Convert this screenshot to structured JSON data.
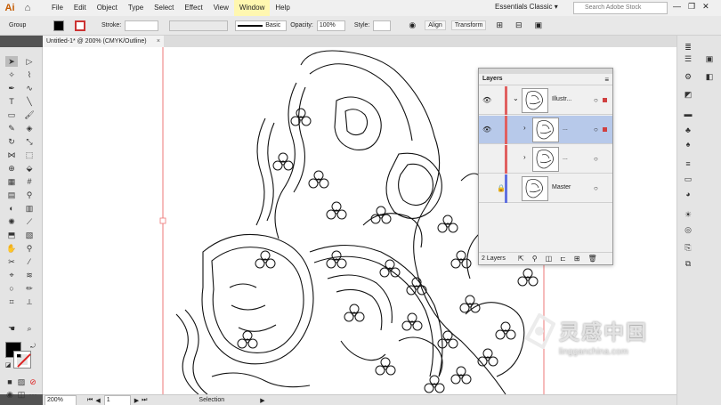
{
  "app": {
    "logo": "Ai",
    "workspace": "Essentials Classic",
    "search_placeholder": "Search Adobe Stock"
  },
  "menus": [
    "File",
    "Edit",
    "Object",
    "Type",
    "Select",
    "Effect",
    "View",
    "Window",
    "Help"
  ],
  "active_menu": "Window",
  "control": {
    "selection_label": "Group",
    "stroke_label": "Stroke:",
    "brush_label": "Basic",
    "opacity_label": "Opacity:",
    "opacity_value": "100%",
    "style_label": "Style:",
    "align_label": "Align",
    "transform_label": "Transform"
  },
  "document_tab": {
    "title": "Untitled-1* @ 200% (CMYK/Outline)",
    "close": "×"
  },
  "layers_panel": {
    "title": "Layers",
    "layers": [
      {
        "name": "Illustr...",
        "bar_color": "#e06060",
        "expanded": true,
        "visible": true,
        "locked": false,
        "selected": false
      },
      {
        "name": "...",
        "bar_color": "#e06060",
        "expanded": false,
        "visible": true,
        "locked": false,
        "selected": true
      },
      {
        "name": "...",
        "bar_color": "#e06060",
        "expanded": false,
        "visible": false,
        "locked": false,
        "selected": false
      },
      {
        "name": "Master",
        "bar_color": "#6070e0",
        "expanded": false,
        "visible": false,
        "locked": true,
        "selected": false
      }
    ],
    "count_label": "2 Layers"
  },
  "status": {
    "zoom": "200%",
    "page": "1",
    "tool": "Selection"
  },
  "watermark": {
    "text": "灵感中国",
    "url": "lingganchina.com"
  }
}
